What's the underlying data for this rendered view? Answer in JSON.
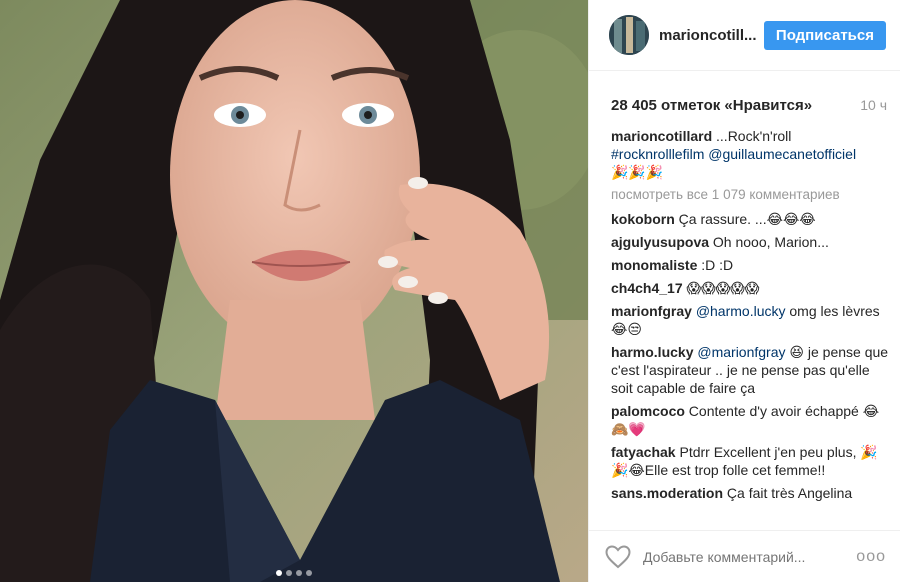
{
  "post": {
    "username": "marioncotill...",
    "follow_label": "Подписаться",
    "likes": "28 405 отметок «Нравится»",
    "time": "10 ч",
    "caption": {
      "user": "marioncotillard",
      "text": "...Rock'n'roll",
      "hashtag": "#rocknrolllefilm",
      "mention": "@guillaumecanetofficiel",
      "emoji": "🎉🎉🎉"
    },
    "view_all": "посмотреть все 1 079 комментариев",
    "comments": [
      {
        "user": "kokoborn",
        "pre": "",
        "mention": "",
        "text": "Ça rassure. ...😂😂😂"
      },
      {
        "user": "ajgulyusupova",
        "pre": "",
        "mention": "",
        "text": "Oh nooo, Marion..."
      },
      {
        "user": "monomaliste",
        "pre": "",
        "mention": "",
        "text": ":D :D"
      },
      {
        "user": "ch4ch4_17",
        "pre": "",
        "mention": "",
        "text": "😱😱😱😱😱"
      },
      {
        "user": "marionfgray",
        "pre": "",
        "mention": "@harmo.lucky",
        "text": "omg les lèvres 😂😒"
      },
      {
        "user": "harmo.lucky",
        "pre": "",
        "mention": "@marionfgray",
        "text": "😆 je pense que c'est l'aspirateur .. je ne pense pas qu'elle soit capable de faire ça"
      },
      {
        "user": "palomcoco",
        "pre": "",
        "mention": "",
        "text": "Contente d'y avoir échappé 😂🙈💗"
      },
      {
        "user": "fatyachak",
        "pre": "",
        "mention": "",
        "text": "Ptdrr Excellent j'en peu plus, 🎉🎉😂Elle est trop folle cet femme!!"
      },
      {
        "user": "sans.moderation",
        "pre": "",
        "mention": "",
        "text": "Ça fait très Angelina"
      }
    ],
    "add_comment_placeholder": "Добавьте комментарий...",
    "options_label": "ooo",
    "icons": {
      "like": "heart-outline-icon",
      "options": "more-options-icon"
    },
    "colors": {
      "accent": "#3897f0",
      "link": "#003569",
      "muted": "#999999"
    }
  }
}
